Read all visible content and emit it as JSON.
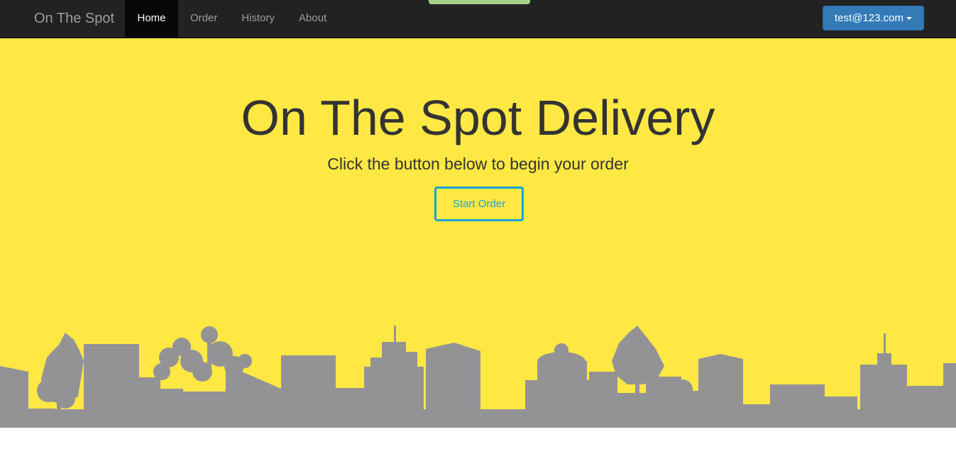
{
  "navbar": {
    "brand": "On The Spot",
    "items": [
      {
        "label": "Home",
        "active": true
      },
      {
        "label": "Order",
        "active": false
      },
      {
        "label": "History",
        "active": false
      },
      {
        "label": "About",
        "active": false
      }
    ],
    "user": {
      "email": "test@123.com",
      "icon": "chevron-down-icon"
    }
  },
  "hero": {
    "title": "On The Spot Delivery",
    "subtitle": "Click the button below to begin your order",
    "button": "Start Order",
    "background_color": "#ffe843",
    "skyline_color": "#939396",
    "button_color": "#1ba1d8"
  },
  "colors": {
    "navbar": "#222222",
    "top_tab": "#a6d088",
    "user_button": "#337ab7"
  }
}
